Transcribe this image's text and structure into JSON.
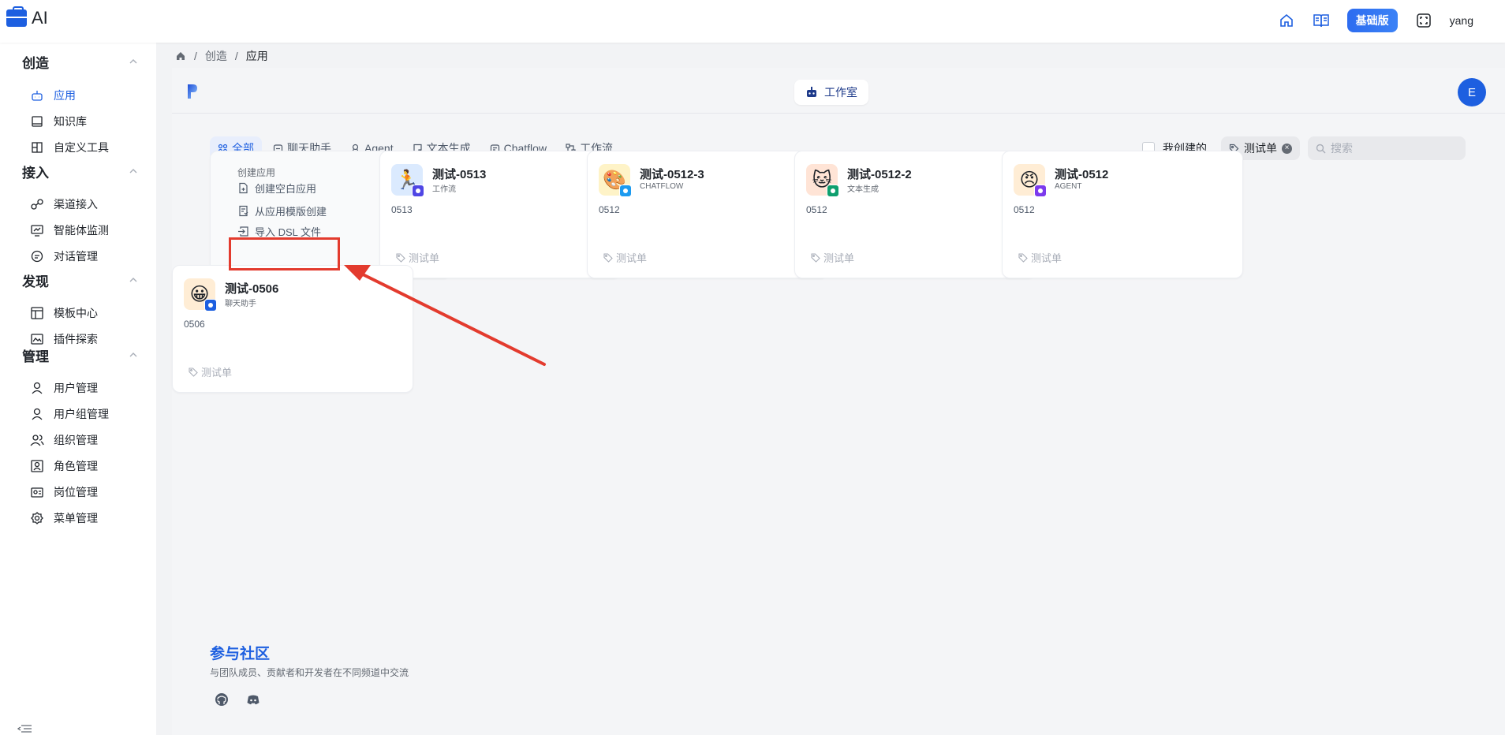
{
  "header": {
    "logo_text": "AI",
    "plan_badge": "基础版",
    "username": "yang",
    "icons": [
      "home-icon",
      "book-icon",
      "fullscreen-icon"
    ]
  },
  "sidebar": {
    "groups": [
      {
        "title": "创造",
        "items": [
          "应用",
          "知识库",
          "自定义工具"
        ]
      },
      {
        "title": "接入",
        "items": [
          "渠道接入",
          "智能体监测",
          "对话管理"
        ]
      },
      {
        "title": "发现",
        "items": [
          "模板中心",
          "插件探索"
        ]
      },
      {
        "title": "管理",
        "items": [
          "用户管理",
          "用户组管理",
          "组织管理",
          "角色管理",
          "岗位管理",
          "菜单管理"
        ]
      }
    ],
    "active_item": "应用"
  },
  "breadcrumb": {
    "items": [
      "创造",
      "应用"
    ]
  },
  "main": {
    "studio_label": "工作室",
    "avatar_letter": "E",
    "tabs": [
      "全部",
      "聊天助手",
      "Agent",
      "文本生成",
      "Chatflow",
      "工作流"
    ],
    "active_tab": "全部",
    "mine_label": "我创建的",
    "tag_filter": "测试单",
    "search_placeholder": "搜索",
    "create_card": {
      "title": "创建应用",
      "options": [
        "创建空白应用",
        "从应用模版创建",
        "导入 DSL 文件"
      ]
    },
    "apps": [
      {
        "name": "测试-0513",
        "type": "工作流",
        "desc": "0513",
        "tag": "测试单",
        "icon": "runner-emoji",
        "badge_color": "#4f46e5"
      },
      {
        "name": "测试-0512-3",
        "type": "CHATFLOW",
        "desc": "0512",
        "tag": "测试单",
        "icon": "palette-emoji",
        "badge_color": "#1d9bf0"
      },
      {
        "name": "测试-0512-2",
        "type": "文本生成",
        "desc": "0512",
        "tag": "测试单",
        "icon": "cat-emoji",
        "badge_color": "#0e9f6e"
      },
      {
        "name": "测试-0512",
        "type": "AGENT",
        "desc": "0512",
        "tag": "测试单",
        "icon": "angry-face-emoji",
        "badge_color": "#7c3aed"
      },
      {
        "name": "测试-0506",
        "type": "聊天助手",
        "desc": "0506",
        "tag": "测试单",
        "icon": "grin-face-emoji",
        "badge_color": "#1d5fe0"
      }
    ],
    "community": {
      "title": "参与社区",
      "desc": "与团队成员、贡献者和开发者在不同频道中交流",
      "icons": [
        "github-icon",
        "discord-icon"
      ]
    }
  },
  "colors": {
    "accent": "#1d5fe0",
    "annotation_red": "#e33b2e"
  }
}
